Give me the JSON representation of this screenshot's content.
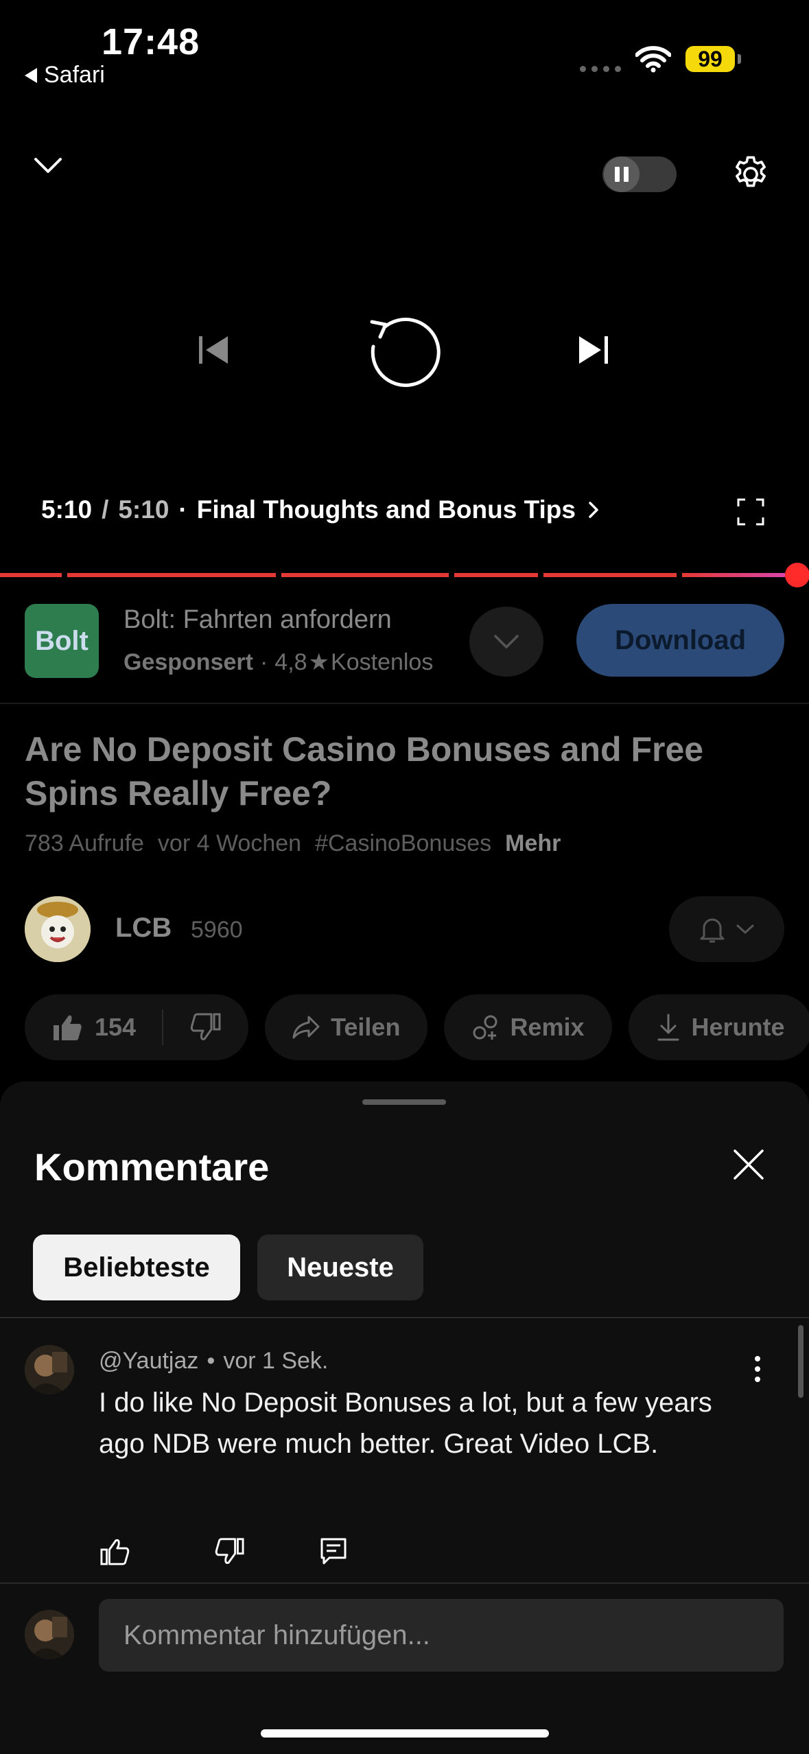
{
  "status_bar": {
    "time": "17:48",
    "back_app": "Safari",
    "battery": "99"
  },
  "player": {
    "current_time": "5:10",
    "duration": "5:10",
    "chapter": "Final Thoughts and Bonus Tips",
    "progress_fraction": 1.0,
    "icons": [
      "chevron-down-icon",
      "pause-icon",
      "gear-icon",
      "skip-previous-icon",
      "replay-icon",
      "skip-next-icon",
      "chevron-right-icon",
      "fullscreen-icon"
    ]
  },
  "ad": {
    "logo_text": "Bolt",
    "title": "Bolt: Fahrten anfordern",
    "sponsored": "Gesponsert",
    "rating": "4,8",
    "price": "Kostenlos",
    "cta": "Download"
  },
  "video": {
    "title": "Are No Deposit Casino Bonuses and Free Spins Really Free?",
    "views": "783 Aufrufe",
    "age": "vor 4 Wochen",
    "hashtag": "#CasinoBonuses",
    "more": "Mehr"
  },
  "channel": {
    "name": "LCB",
    "subscribers": "5960"
  },
  "actions": {
    "likes": "154",
    "share": "Teilen",
    "remix": "Remix",
    "download": "Herunte"
  },
  "comments": {
    "title": "Kommentare",
    "tabs": {
      "top": "Beliebteste",
      "newest": "Neueste"
    },
    "items": [
      {
        "author": "@Yautjaz",
        "time": "vor 1 Sek.",
        "text": "I do like No Deposit Bonuses a lot, but a few years ago NDB were much better. Great Video LCB."
      }
    ],
    "add_placeholder": "Kommentar hinzufügen..."
  },
  "colors": {
    "accent": "#e53935",
    "ad_button": "#2b4a78",
    "battery": "#f5d90a"
  }
}
